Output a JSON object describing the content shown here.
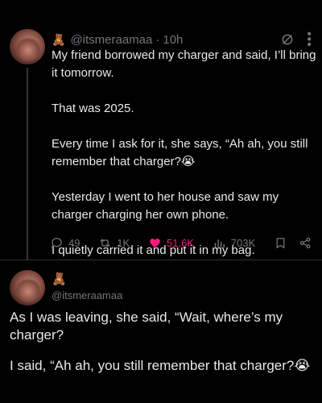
{
  "post1": {
    "emoji": "🧸",
    "handle": "@itsmeraamaa",
    "separator": "·",
    "time": "10h",
    "paragraphs": [
      "My friend borrowed my charger and said, I’ll bring it tomorrow.",
      "That was 2025.",
      "Every time I ask for it, she says, “Ah ah, you still remember that charger?😭",
      "Yesterday I went to her house and saw my charger charging her own phone.",
      "I quietly carried it and put it in my bag."
    ],
    "actions": {
      "replies": "49",
      "reposts": "1K",
      "likes": "51.6K",
      "views": "703K"
    },
    "colors": {
      "like": "#f91880",
      "muted": "#71767b"
    }
  },
  "post2": {
    "emoji": "🧸",
    "handle": "@itsmeraamaa",
    "paragraphs": [
      "As I was leaving, she said, “Wait, where’s my charger?",
      "I said, “Ah ah, you still remember that charger?😭"
    ]
  }
}
